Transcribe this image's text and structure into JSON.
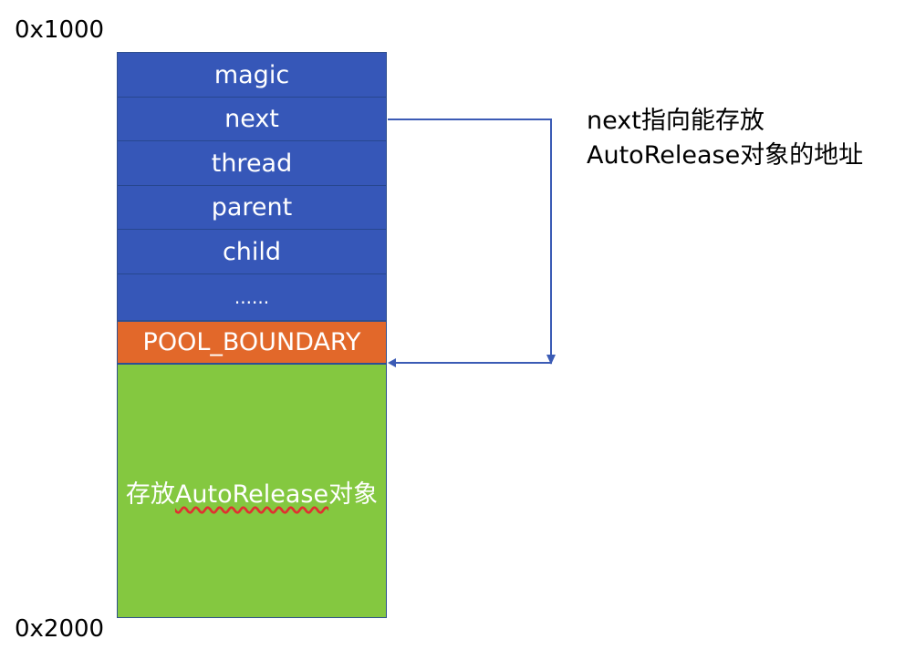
{
  "addresses": {
    "top": "0x1000",
    "bottom": "0x2000"
  },
  "stack": {
    "fields": [
      "magic",
      "next",
      "thread",
      "parent",
      "child",
      "......"
    ],
    "boundary": "POOL_BOUNDARY",
    "storage_prefix": "存放",
    "storage_mid": "AutoRelease",
    "storage_suffix": "对象"
  },
  "note": {
    "line1": "next指向能存放",
    "line2": "AutoRelease对象的地址"
  },
  "colors": {
    "field": "#3657b8",
    "boundary": "#e2682a",
    "storage": "#84c840",
    "arrow": "#3b5bb5"
  }
}
